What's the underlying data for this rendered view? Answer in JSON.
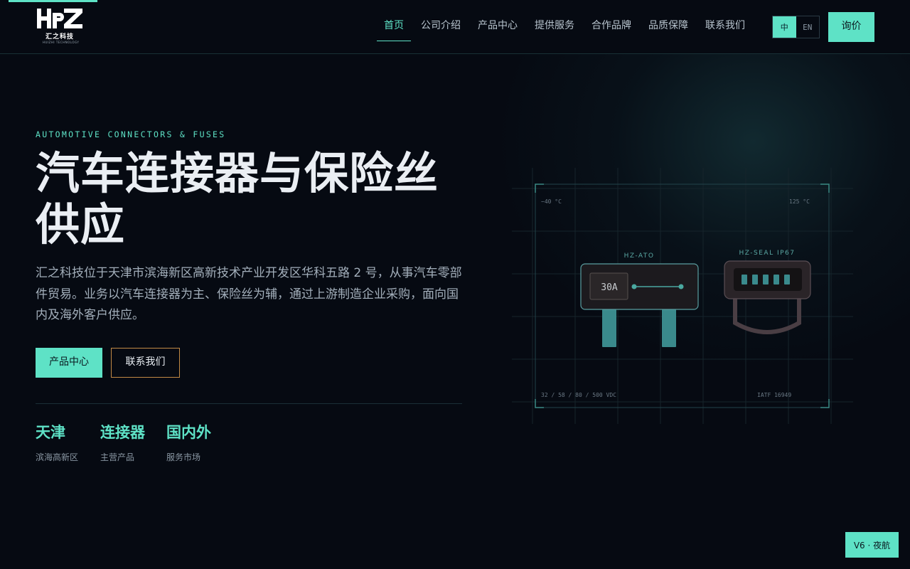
{
  "header": {
    "logo_mark": "HPZ",
    "logo_cn": "汇之科技",
    "logo_en": "HUIZHI TECHNOLOGY",
    "nav": [
      {
        "label": "首页",
        "active": true
      },
      {
        "label": "公司介绍",
        "active": false
      },
      {
        "label": "产品中心",
        "active": false
      },
      {
        "label": "提供服务",
        "active": false
      },
      {
        "label": "合作品牌",
        "active": false
      },
      {
        "label": "品质保障",
        "active": false
      },
      {
        "label": "联系我们",
        "active": false
      }
    ],
    "lang": {
      "zh": "中",
      "en": "EN",
      "selected": "zh"
    },
    "inquiry_label": "询价"
  },
  "hero": {
    "eyebrow": "AUTOMOTIVE CONNECTORS & FUSES",
    "title": "汽车连接器与保险丝供应",
    "description": "汇之科技位于天津市滨海新区高新技术产业开发区华科五路 2 号，从事汽车零部件贸易。业务以汽车连接器为主、保险丝为辅，通过上游制造企业采购，面向国内及海外客户供应。",
    "primary_button": "产品中心",
    "secondary_button": "联系我们",
    "stats": [
      {
        "value": "天津",
        "label": "滨海高新区"
      },
      {
        "value": "连接器",
        "label": "主营产品"
      },
      {
        "value": "国内外",
        "label": "服务市场"
      }
    ]
  },
  "visual": {
    "temp_min": "−40 °C",
    "temp_max": "125 °C",
    "voltage": "32 / 58 / 80 / 500 VDC",
    "certification": "IATF 16949",
    "fuse_label": "HZ-ATO",
    "fuse_rating": "30A",
    "connector_label": "HZ-SEAL IP67"
  },
  "version_badge": "V6 · 夜航",
  "colors": {
    "accent": "#5ee2c6",
    "background": "#060a12",
    "outline_button": "#c28a45"
  }
}
